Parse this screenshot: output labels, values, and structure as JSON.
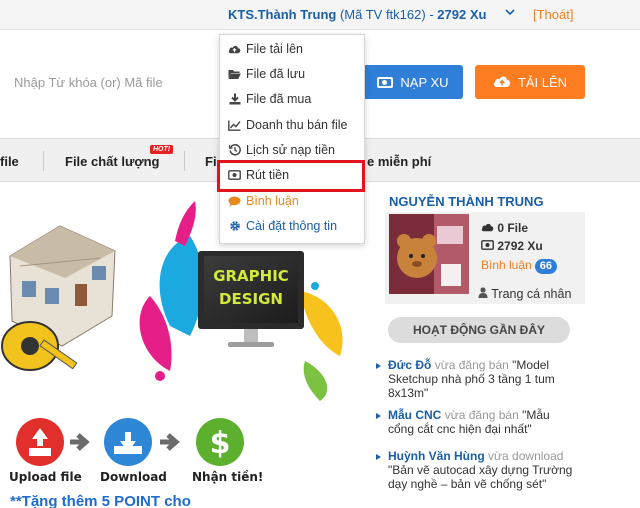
{
  "header": {
    "user_name": "KTS.Thành Trung",
    "member_id": "(Mã TV ftk162)",
    "separator": "-",
    "points": "2792 Xu",
    "logout": "[Thoát]"
  },
  "search": {
    "placeholder": "Nhập Từ khóa (or) Mã file",
    "topup_label": "NẠP XU",
    "upload_label": "TẢI LÊN"
  },
  "nav": {
    "items": [
      "file",
      "File chất lượng",
      "Fi",
      "e miễn phí"
    ],
    "hot_badge": "HOT!"
  },
  "dropdown": {
    "items": [
      {
        "label": "File tải lên",
        "icon": "cloud-upload-icon"
      },
      {
        "label": "File đã lưu",
        "icon": "folder-open-icon"
      },
      {
        "label": "File đã mua",
        "icon": "download-icon"
      },
      {
        "label": "Doanh thu bán file",
        "icon": "line-chart-icon"
      },
      {
        "label": "Lịch sử nạp tiền",
        "icon": "history-icon"
      },
      {
        "label": "Rút tiền",
        "icon": "money-icon"
      },
      {
        "label": "Bình luận",
        "icon": "comment-icon"
      },
      {
        "label": "Cài đặt thông tin",
        "icon": "gear-icon"
      }
    ],
    "highlighted_index": 5
  },
  "banner": {
    "monitor_text_1": "GRAPHIC",
    "monitor_text_2": "DESIGN",
    "steps": [
      "Upload file",
      "Download",
      "Nhận tiền!"
    ],
    "promo": "**Tặng thêm 5 POINT cho"
  },
  "profile": {
    "name": "NGUYỄN THÀNH TRUNG",
    "files": "0 File",
    "points": "2792 Xu",
    "comments_label": "Bình luận",
    "comments_count": "66",
    "profile_link": "Trang cá nhân"
  },
  "activity": {
    "heading": "HOẠT ĐỘNG GẦN ĐÂY",
    "items": [
      {
        "who": "Đức Đỗ",
        "verb": "vừa đăng bán",
        "text": "\"Model Sketchup nhà phố 3 tầng 1 tum 8x13m\""
      },
      {
        "who": "Mẫu CNC",
        "verb": "vừa đăng bán",
        "text": "\"Mẫu cổng cắt cnc hiện đại nhất\""
      },
      {
        "who": "Huỳnh Văn Hùng",
        "verb": "vừa download",
        "text": "\"Bản vẽ autocad xây dựng Trường dạy nghề – bản vẽ chống sét\""
      }
    ]
  },
  "colors": {
    "brand_blue": "#2f7fd8",
    "orange": "#ff7d21",
    "highlight_red": "#e0141c",
    "link_blue": "#1a5ea8"
  }
}
